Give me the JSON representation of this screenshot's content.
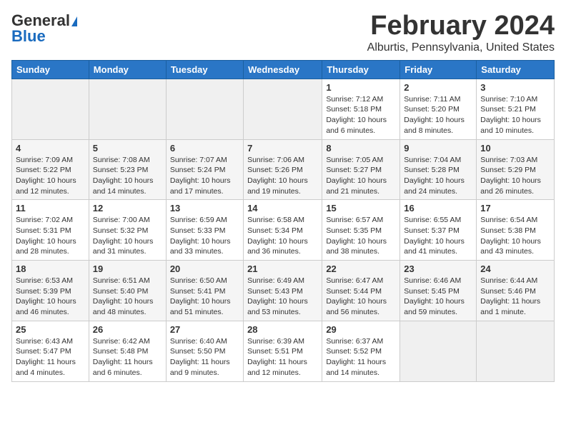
{
  "logo": {
    "general": "General",
    "blue": "Blue"
  },
  "header": {
    "month": "February 2024",
    "location": "Alburtis, Pennsylvania, United States"
  },
  "weekdays": [
    "Sunday",
    "Monday",
    "Tuesday",
    "Wednesday",
    "Thursday",
    "Friday",
    "Saturday"
  ],
  "weeks": [
    [
      {
        "day": "",
        "info": ""
      },
      {
        "day": "",
        "info": ""
      },
      {
        "day": "",
        "info": ""
      },
      {
        "day": "",
        "info": ""
      },
      {
        "day": "1",
        "info": "Sunrise: 7:12 AM\nSunset: 5:18 PM\nDaylight: 10 hours\nand 6 minutes."
      },
      {
        "day": "2",
        "info": "Sunrise: 7:11 AM\nSunset: 5:20 PM\nDaylight: 10 hours\nand 8 minutes."
      },
      {
        "day": "3",
        "info": "Sunrise: 7:10 AM\nSunset: 5:21 PM\nDaylight: 10 hours\nand 10 minutes."
      }
    ],
    [
      {
        "day": "4",
        "info": "Sunrise: 7:09 AM\nSunset: 5:22 PM\nDaylight: 10 hours\nand 12 minutes."
      },
      {
        "day": "5",
        "info": "Sunrise: 7:08 AM\nSunset: 5:23 PM\nDaylight: 10 hours\nand 14 minutes."
      },
      {
        "day": "6",
        "info": "Sunrise: 7:07 AM\nSunset: 5:24 PM\nDaylight: 10 hours\nand 17 minutes."
      },
      {
        "day": "7",
        "info": "Sunrise: 7:06 AM\nSunset: 5:26 PM\nDaylight: 10 hours\nand 19 minutes."
      },
      {
        "day": "8",
        "info": "Sunrise: 7:05 AM\nSunset: 5:27 PM\nDaylight: 10 hours\nand 21 minutes."
      },
      {
        "day": "9",
        "info": "Sunrise: 7:04 AM\nSunset: 5:28 PM\nDaylight: 10 hours\nand 24 minutes."
      },
      {
        "day": "10",
        "info": "Sunrise: 7:03 AM\nSunset: 5:29 PM\nDaylight: 10 hours\nand 26 minutes."
      }
    ],
    [
      {
        "day": "11",
        "info": "Sunrise: 7:02 AM\nSunset: 5:31 PM\nDaylight: 10 hours\nand 28 minutes."
      },
      {
        "day": "12",
        "info": "Sunrise: 7:00 AM\nSunset: 5:32 PM\nDaylight: 10 hours\nand 31 minutes."
      },
      {
        "day": "13",
        "info": "Sunrise: 6:59 AM\nSunset: 5:33 PM\nDaylight: 10 hours\nand 33 minutes."
      },
      {
        "day": "14",
        "info": "Sunrise: 6:58 AM\nSunset: 5:34 PM\nDaylight: 10 hours\nand 36 minutes."
      },
      {
        "day": "15",
        "info": "Sunrise: 6:57 AM\nSunset: 5:35 PM\nDaylight: 10 hours\nand 38 minutes."
      },
      {
        "day": "16",
        "info": "Sunrise: 6:55 AM\nSunset: 5:37 PM\nDaylight: 10 hours\nand 41 minutes."
      },
      {
        "day": "17",
        "info": "Sunrise: 6:54 AM\nSunset: 5:38 PM\nDaylight: 10 hours\nand 43 minutes."
      }
    ],
    [
      {
        "day": "18",
        "info": "Sunrise: 6:53 AM\nSunset: 5:39 PM\nDaylight: 10 hours\nand 46 minutes."
      },
      {
        "day": "19",
        "info": "Sunrise: 6:51 AM\nSunset: 5:40 PM\nDaylight: 10 hours\nand 48 minutes."
      },
      {
        "day": "20",
        "info": "Sunrise: 6:50 AM\nSunset: 5:41 PM\nDaylight: 10 hours\nand 51 minutes."
      },
      {
        "day": "21",
        "info": "Sunrise: 6:49 AM\nSunset: 5:43 PM\nDaylight: 10 hours\nand 53 minutes."
      },
      {
        "day": "22",
        "info": "Sunrise: 6:47 AM\nSunset: 5:44 PM\nDaylight: 10 hours\nand 56 minutes."
      },
      {
        "day": "23",
        "info": "Sunrise: 6:46 AM\nSunset: 5:45 PM\nDaylight: 10 hours\nand 59 minutes."
      },
      {
        "day": "24",
        "info": "Sunrise: 6:44 AM\nSunset: 5:46 PM\nDaylight: 11 hours\nand 1 minute."
      }
    ],
    [
      {
        "day": "25",
        "info": "Sunrise: 6:43 AM\nSunset: 5:47 PM\nDaylight: 11 hours\nand 4 minutes."
      },
      {
        "day": "26",
        "info": "Sunrise: 6:42 AM\nSunset: 5:48 PM\nDaylight: 11 hours\nand 6 minutes."
      },
      {
        "day": "27",
        "info": "Sunrise: 6:40 AM\nSunset: 5:50 PM\nDaylight: 11 hours\nand 9 minutes."
      },
      {
        "day": "28",
        "info": "Sunrise: 6:39 AM\nSunset: 5:51 PM\nDaylight: 11 hours\nand 12 minutes."
      },
      {
        "day": "29",
        "info": "Sunrise: 6:37 AM\nSunset: 5:52 PM\nDaylight: 11 hours\nand 14 minutes."
      },
      {
        "day": "",
        "info": ""
      },
      {
        "day": "",
        "info": ""
      }
    ]
  ]
}
